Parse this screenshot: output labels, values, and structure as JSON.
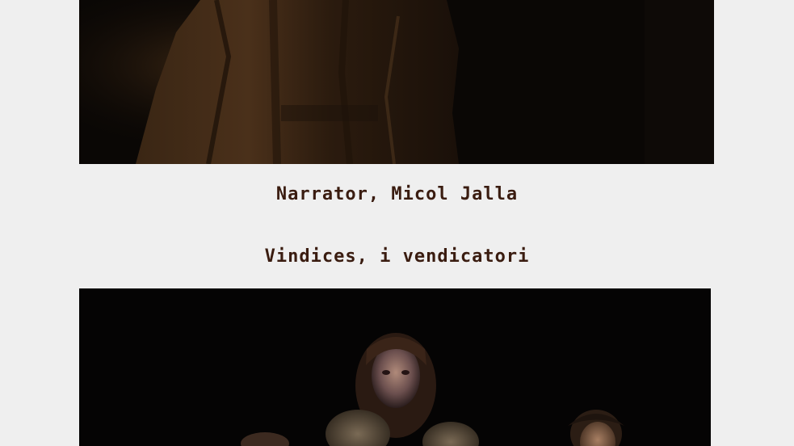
{
  "captions": {
    "narrator": "Narrator, Micol Jalla",
    "vindices": "Vindices, i vendicatori"
  }
}
